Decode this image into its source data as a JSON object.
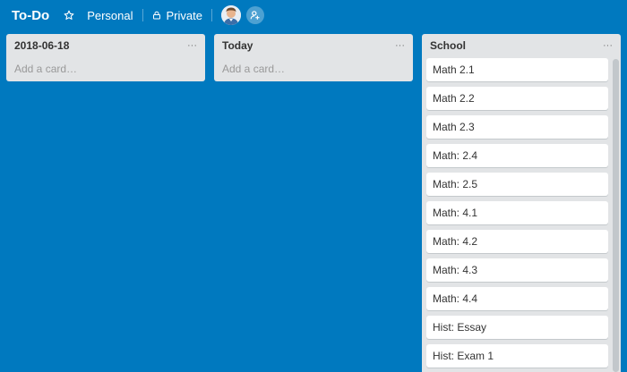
{
  "header": {
    "board_title": "To-Do",
    "team_label": "Personal",
    "visibility_label": "Private"
  },
  "lists": [
    {
      "title": "2018-06-18",
      "menu_label": "···",
      "add_card_label": "Add a card…"
    },
    {
      "title": "Today",
      "menu_label": "···",
      "add_card_label": "Add a card…"
    },
    {
      "title": "School",
      "menu_label": "···",
      "cards": [
        "Math 2.1",
        "Math 2.2",
        "Math 2.3",
        "Math: 2.4",
        "Math: 2.5",
        "Math: 4.1",
        "Math: 4.2",
        "Math: 4.3",
        "Math: 4.4",
        "Hist: Essay",
        "Hist: Exam 1"
      ]
    }
  ],
  "colors": {
    "board_background": "#0079bf",
    "list_background": "#e2e4e6",
    "card_background": "#ffffff"
  }
}
